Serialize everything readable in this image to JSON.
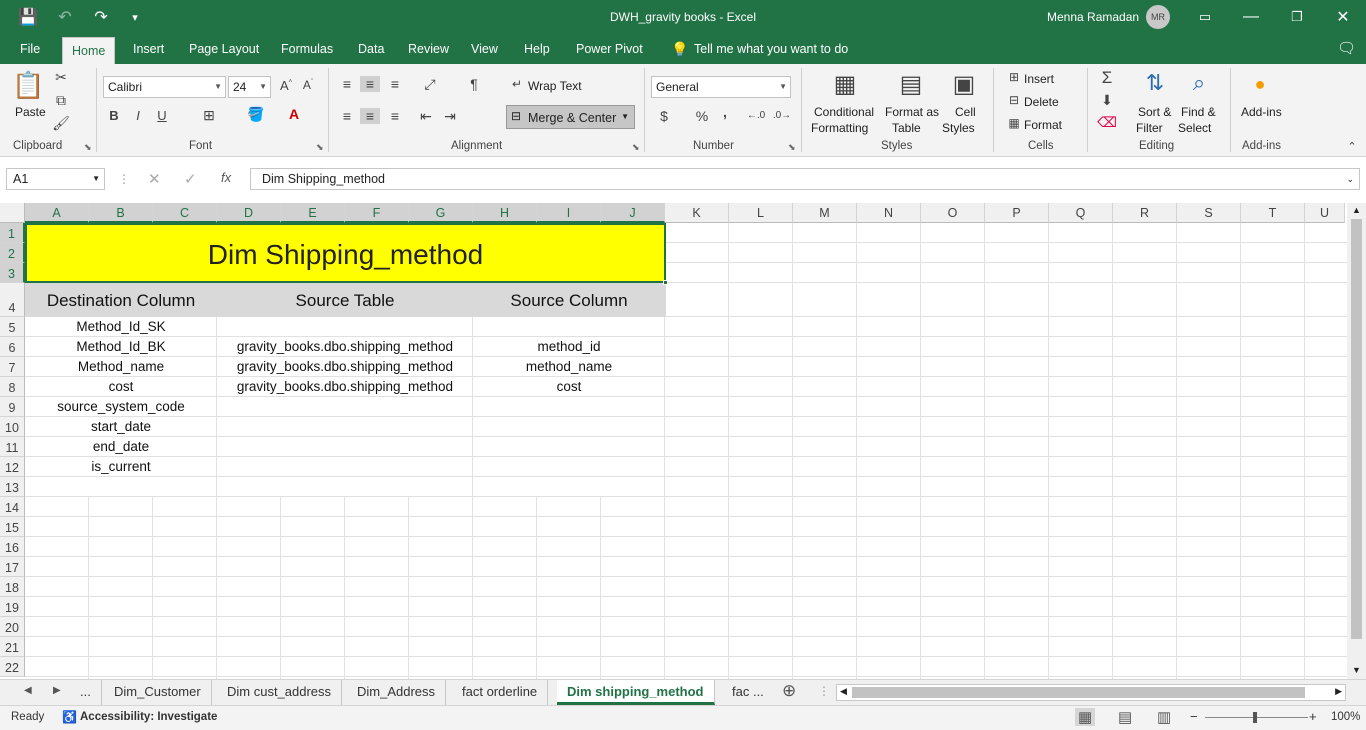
{
  "window": {
    "title": "DWH_gravity books  -  Excel",
    "user": "Menna Ramadan",
    "user_initials": "MR"
  },
  "ribbon_tabs": [
    "File",
    "Home",
    "Insert",
    "Page Layout",
    "Formulas",
    "Data",
    "Review",
    "View",
    "Help",
    "Power Pivot"
  ],
  "tell_me": "Tell me what you want to do",
  "ribbon": {
    "clipboard": {
      "paste": "Paste",
      "label": "Clipboard"
    },
    "font": {
      "name": "Calibri",
      "size": "24",
      "label": "Font",
      "bold": "B",
      "italic": "I",
      "underline": "U"
    },
    "alignment": {
      "wrap_text": "Wrap Text",
      "merge_center": "Merge & Center",
      "label": "Alignment"
    },
    "number": {
      "format": "General",
      "currency": "$",
      "percent": "%",
      "comma": ",",
      "label": "Number"
    },
    "styles": {
      "conditional": "Conditional",
      "conditional2": "Formatting",
      "format_table": "Format as",
      "format_table2": "Table",
      "cell_styles": "Cell",
      "cell_styles2": "Styles",
      "label": "Styles"
    },
    "cells": {
      "insert": "Insert",
      "delete": "Delete",
      "format": "Format",
      "label": "Cells"
    },
    "editing": {
      "sort": "Sort &",
      "sort2": "Filter",
      "find": "Find &",
      "find2": "Select",
      "label": "Editing"
    },
    "addins": {
      "button": "Add-ins",
      "label": "Add-ins"
    }
  },
  "formula_bar": {
    "name_box": "A1",
    "formula": "Dim Shipping_method"
  },
  "columns": [
    "A",
    "B",
    "C",
    "D",
    "E",
    "F",
    "G",
    "H",
    "I",
    "J",
    "K",
    "L",
    "M",
    "N",
    "O",
    "P",
    "Q",
    "R",
    "S",
    "T",
    "U"
  ],
  "rows": [
    "1",
    "2",
    "3",
    "4",
    "5",
    "6",
    "7",
    "8",
    "9",
    "10",
    "11",
    "12",
    "13",
    "14",
    "15",
    "16",
    "17",
    "18",
    "19",
    "20",
    "21",
    "22"
  ],
  "sheet": {
    "title": "Dim Shipping_method",
    "headers": {
      "dest": "Destination Column",
      "src_table": "Source Table",
      "src_col": "Source  Column"
    },
    "table_rows": [
      {
        "dest": "Method_Id_SK",
        "src_table": "",
        "src_col": ""
      },
      {
        "dest": "Method_Id_BK",
        "src_table": "gravity_books.dbo.shipping_method",
        "src_col": "method_id"
      },
      {
        "dest": "Method_name",
        "src_table": "gravity_books.dbo.shipping_method",
        "src_col": "method_name"
      },
      {
        "dest": "cost",
        "src_table": "gravity_books.dbo.shipping_method",
        "src_col": "cost"
      },
      {
        "dest": "source_system_code",
        "src_table": "",
        "src_col": ""
      },
      {
        "dest": "start_date",
        "src_table": "",
        "src_col": ""
      },
      {
        "dest": "end_date",
        "src_table": "",
        "src_col": ""
      },
      {
        "dest": "is_current",
        "src_table": "",
        "src_col": ""
      }
    ]
  },
  "sheet_tabs": [
    "Dim_Customer",
    "Dim cust_address",
    "Dim_Address",
    "fact orderline",
    "Dim shipping_method",
    "fac ..."
  ],
  "sheet_tabs_overflow": "...",
  "status": {
    "ready": "Ready",
    "accessibility": "Accessibility: Investigate",
    "zoom": "100%"
  },
  "colors": {
    "excel_green": "#217346",
    "title_fill": "#ffff00",
    "header_fill": "#d9d9d9"
  }
}
